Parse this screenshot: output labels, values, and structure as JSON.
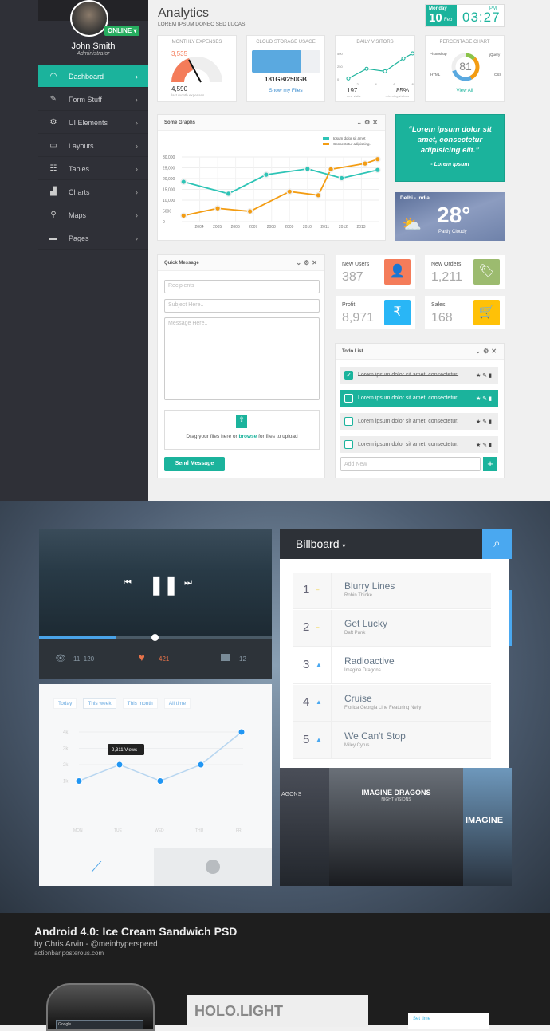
{
  "sidebar": {
    "user": {
      "name": "John Smith",
      "role": "Administrator",
      "status": "ONLINE ▾"
    },
    "items": [
      {
        "label": "Dashboard",
        "icon": "gauge-icon",
        "active": true
      },
      {
        "label": "Form Stuff",
        "icon": "pencil-icon"
      },
      {
        "label": "UI Elements",
        "icon": "gear-icon"
      },
      {
        "label": "Layouts",
        "icon": "monitor-icon"
      },
      {
        "label": "Tables",
        "icon": "table-icon"
      },
      {
        "label": "Charts",
        "icon": "bar-chart-icon"
      },
      {
        "label": "Maps",
        "icon": "map-pin-icon"
      },
      {
        "label": "Pages",
        "icon": "folder-icon"
      }
    ]
  },
  "header": {
    "title": "Analytics",
    "subtitle": "LOREM IPSUM DONEC SED LUCAS",
    "date": {
      "day": "Monday",
      "num": "10",
      "month": "Feb"
    },
    "time": "03:27",
    "ampm": "PM"
  },
  "widgets": {
    "expenses": {
      "title": "MONTHLY EXPENSES",
      "value": "3,535",
      "last": "4,590",
      "last_label": "last month expenses",
      "gauge_fraction": 0.45
    },
    "storage": {
      "title": "CLOUD STORAGE USAGE",
      "value": "181GB/250GB",
      "link": "Show my Files",
      "fraction": 0.724
    },
    "visitors": {
      "title": "DAILY VISITORS",
      "yticks": [
        "500",
        "250",
        "0"
      ],
      "xticks": [
        "2",
        "4",
        "6",
        "8"
      ],
      "points": [
        [
          1,
          10
        ],
        [
          3,
          200
        ],
        [
          5,
          150
        ],
        [
          7,
          400
        ],
        [
          8,
          500
        ]
      ],
      "new": "197",
      "new_label": "new visits",
      "ret": "85%",
      "ret_label": "returning visitors"
    },
    "percent": {
      "title": "PERCENTAGE CHART",
      "value": "81",
      "labels": [
        "Photoshop",
        "jQuery",
        "HTML",
        "CSS"
      ],
      "link": "View All"
    }
  },
  "graph": {
    "title": "Some Graphs",
    "chart_data": {
      "type": "line",
      "xticks": [
        "2004",
        "2005",
        "2006",
        "2007",
        "2008",
        "2009",
        "2010",
        "2011",
        "2012",
        "2013"
      ],
      "yticks": [
        "30,000",
        "25,000",
        "20,000",
        "15,000",
        "10,000",
        "5000",
        "0"
      ],
      "ylim": [
        0,
        30000
      ],
      "xlim": [
        2003,
        2014
      ],
      "grid": true,
      "legend": "top-right",
      "series": [
        {
          "name": "Ipsum dolor sit amet",
          "color": "#2ec4b6",
          "points": [
            [
              2003.1,
              18500
            ],
            [
              2005.6,
              13000
            ],
            [
              2007.7,
              21800
            ],
            [
              2010,
              24500
            ],
            [
              2011.9,
              20200
            ],
            [
              2013.9,
              24000
            ]
          ]
        },
        {
          "name": "Consectetur adipiscing.",
          "color": "#f39c12",
          "points": [
            [
              2003.1,
              2800
            ],
            [
              2005,
              6200
            ],
            [
              2006.8,
              4800
            ],
            [
              2009,
              14000
            ],
            [
              2010.6,
              12300
            ],
            [
              2011.3,
              24300
            ],
            [
              2013.2,
              27000
            ],
            [
              2013.9,
              29000
            ]
          ]
        }
      ]
    }
  },
  "quote": {
    "text": "“Lorem ipsum dolor sit amet, consectetur adipisicing elit.”",
    "author": "- Lorem Ipsum"
  },
  "weather": {
    "city": "Delhi - India",
    "temp": "28°",
    "cond": "Partly Cloudy"
  },
  "message": {
    "title": "Quick Message",
    "recipients": "Recipients",
    "subject": "Subject Here..",
    "body": "Message Here..",
    "drop_pre": "Drag your files here or ",
    "drop_link": "browse",
    "drop_post": " for files to upload",
    "send": "Send Message"
  },
  "stats": [
    {
      "label": "New Users",
      "value": "387",
      "color": "#f47c5a",
      "icon": "user-icon",
      "glyph": "👤"
    },
    {
      "label": "New Orders",
      "value": "1,211",
      "color": "#9cbb6f",
      "icon": "tag-icon",
      "glyph": "🏷"
    },
    {
      "label": "Profit",
      "value": "8,971",
      "color": "#29b6f6",
      "icon": "rupee-icon",
      "glyph": "₹"
    },
    {
      "label": "Sales",
      "value": "168",
      "color": "#ffc107",
      "icon": "cart-icon",
      "glyph": "🛒"
    }
  ],
  "todo": {
    "title": "Todo List",
    "items": [
      {
        "text": "Lorem ipsum dolor sit amet, consectetur.",
        "done": true
      },
      {
        "text": "Lorem ipsum dolor sit amet, consectetur.",
        "done": false
      },
      {
        "text": "Lorem ipsum dolor sit amet, consectetur.",
        "done": false
      },
      {
        "text": "Lorem ipsum dolor sit amet, consectetur.",
        "done": false
      }
    ],
    "placeholder": "Add New",
    "add": "+"
  },
  "player": {
    "views": "11, 120",
    "likes": "421",
    "comments": "12",
    "progress": 0.33
  },
  "views_chart": {
    "tabs": [
      "Today",
      "This week",
      "This month",
      "All time"
    ],
    "active_tab": "This week",
    "chart_data": {
      "type": "line",
      "categories": [
        "MON",
        "TUE",
        "WED",
        "THU",
        "FRI"
      ],
      "values": [
        1000,
        2000,
        1000,
        2000,
        4000
      ],
      "yticks": [
        "4k",
        "3k",
        "2k",
        "1k"
      ],
      "ylim": [
        0,
        4000
      ],
      "tooltip": "2,311 Views",
      "color": "#2196f3"
    }
  },
  "billboard": {
    "title": "Billboard",
    "items": [
      {
        "rank": "1",
        "trend": "–",
        "song": "Blurry Lines",
        "artist": "Robin Thicke"
      },
      {
        "rank": "2",
        "trend": "–",
        "song": "Get Lucky",
        "artist": "Daft Punk"
      },
      {
        "rank": "3",
        "trend": "▲",
        "song": "Radioactive",
        "artist": "Imagine Dragons"
      },
      {
        "rank": "4",
        "trend": "▲",
        "song": "Cruise",
        "artist": "Florida Georgia Line Featuring Nelly"
      },
      {
        "rank": "5",
        "trend": "▲",
        "song": "We Can't Stop",
        "artist": "Miley Cyrus"
      }
    ],
    "albums": [
      "IMAGINE DRAGONS",
      "NIGHT VISIONS",
      "IMAGINE",
      "AGONS"
    ]
  },
  "android": {
    "title": "Android 4.0: Ice Cream Sandwich PSD",
    "byline": "by Chris Arvin - @meinhyperspeed",
    "site": "actionbar.posterous.com",
    "holo": "HOLO.LIGHT",
    "settime": "Set time",
    "search": "Google"
  }
}
